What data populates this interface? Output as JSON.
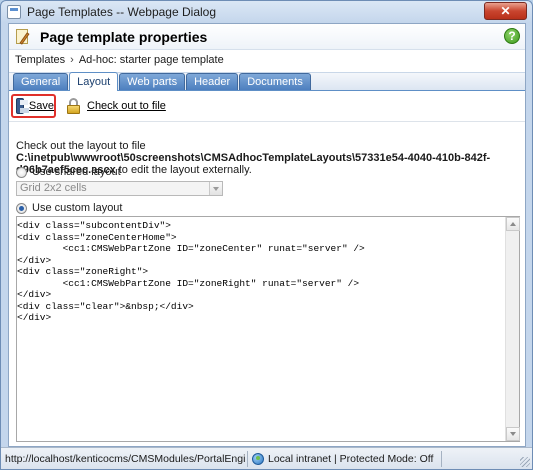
{
  "window": {
    "title": "Page Templates -- Webpage Dialog",
    "close_label": "✕"
  },
  "header": {
    "title": "Page template properties",
    "help_label": "?"
  },
  "breadcrumb": {
    "items": [
      "Templates",
      "Ad-hoc: starter page template"
    ],
    "separator": "›"
  },
  "tabs": [
    {
      "label": "General",
      "active": false
    },
    {
      "label": "Layout",
      "active": true
    },
    {
      "label": "Web parts",
      "active": false
    },
    {
      "label": "Header",
      "active": false
    },
    {
      "label": "Documents",
      "active": false
    }
  ],
  "toolbar": {
    "save_label": "Save",
    "checkout_label": "Check out to file"
  },
  "checkout_info": {
    "prefix": "Check out the layout to file ",
    "path": "C:\\inetpub\\wwwroot\\50screenshots\\CMSAdhocTemplateLayouts\\57331e54-4040-410b-842f-d96b7aef5cec.ascx",
    "suffix": " to edit the layout externally."
  },
  "layout_options": {
    "shared_label": "Use shared layout",
    "shared_selected": "Grid 2x2 cells",
    "custom_label": "Use custom layout",
    "custom_checked": true
  },
  "code": "<div class=\"subcontentDiv\">\n<div class=\"zoneCenterHome\">\n        <cc1:CMSWebPartZone ID=\"zoneCenter\" runat=\"server\" />\n</div>\n<div class=\"zoneRight\">\n        <cc1:CMSWebPartZone ID=\"zoneRight\" runat=\"server\" />\n</div>\n<div class=\"clear\">&nbsp;</div>\n</div>",
  "statusbar": {
    "url": "http://localhost/kenticocms/CMSModules/PortalEngine/UI/Page",
    "zone": "Local intranet | Protected Mode: Off"
  },
  "colors": {
    "accent": "#4d7fbf",
    "highlight_border": "#e0302a",
    "help_green": "#3c9a1c"
  }
}
